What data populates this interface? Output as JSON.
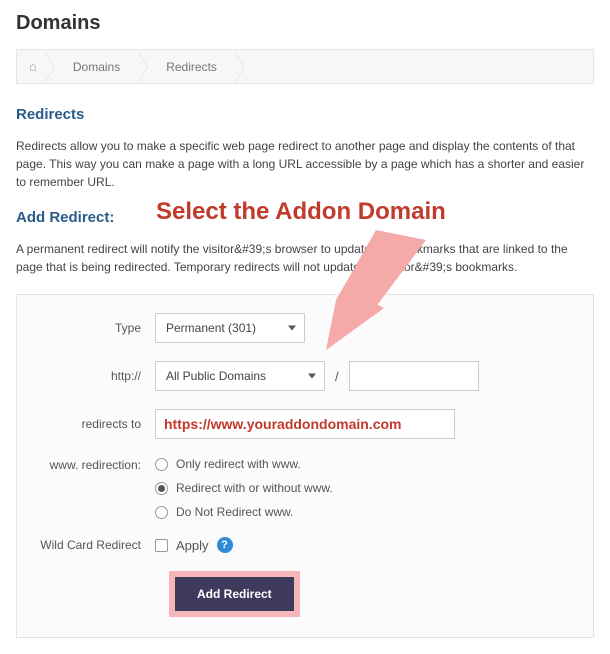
{
  "page": {
    "title": "Domains"
  },
  "breadcrumb": {
    "items": [
      "Domains",
      "Redirects"
    ]
  },
  "section1": {
    "heading": "Redirects",
    "desc": "Redirects allow you to make a specific web page redirect to another page and display the contents of that page. This way you can make a page with a long URL accessible by a page which has a shorter and easier to remember URL."
  },
  "section2": {
    "heading": "Add Redirect:",
    "desc": "A permanent redirect will notify the visitor&#39;s browser to update any bookmarks that are linked to the page that is being redirected. Temporary redirects will not update the visitor&#39;s bookmarks."
  },
  "annotation": {
    "text": "Select the Addon Domain"
  },
  "form": {
    "type": {
      "label": "Type",
      "value": "Permanent (301)"
    },
    "http": {
      "label": "http://",
      "domain_value": "All Public Domains",
      "path_value": "",
      "separator": "/"
    },
    "redirects_to": {
      "label": "redirects to",
      "overlay": "https://www.youraddondomain.com"
    },
    "www": {
      "label": "www. redirection:",
      "options": [
        "Only redirect with www.",
        "Redirect with or without www.",
        "Do Not Redirect www."
      ],
      "selected": 1
    },
    "wildcard": {
      "label": "Wild Card Redirect",
      "apply": "Apply"
    },
    "submit": "Add Redirect"
  }
}
